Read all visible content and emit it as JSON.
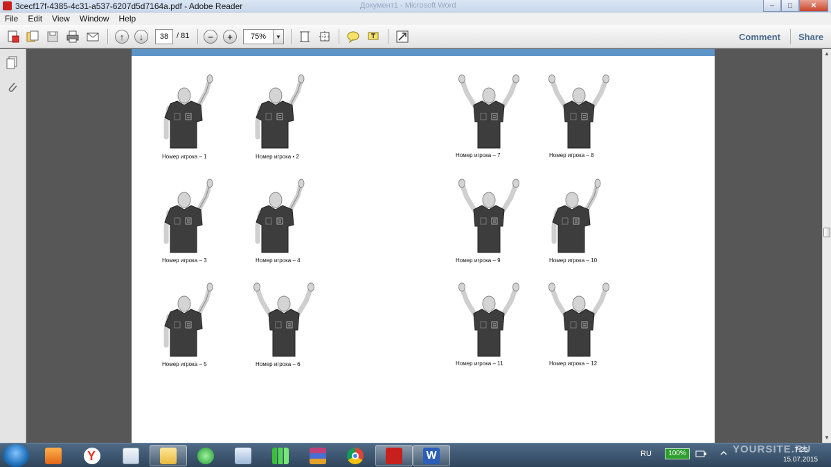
{
  "window": {
    "title": "3cecf17f-4385-4c31-a537-6207d5d7164a.pdf - Adobe Reader",
    "background_title": "Документ1 - Microsoft Word",
    "minimize": "–",
    "maximize": "□",
    "close": "✕"
  },
  "menu": [
    "File",
    "Edit",
    "View",
    "Window",
    "Help"
  ],
  "toolbar": {
    "page_current": "38",
    "page_total": "/ 81",
    "zoom": "75%",
    "comment_label": "Comment",
    "share_label": "Share",
    "icons": [
      "create-pdf-icon",
      "files-icon",
      "save-icon",
      "print-icon",
      "email-icon",
      "prev-page-icon",
      "next-page-icon",
      "zoom-out-icon",
      "zoom-in-icon",
      "fit-page-icon",
      "fit-width-icon",
      "sticky-note-icon",
      "highlight-icon",
      "read-mode-icon"
    ]
  },
  "figures": [
    {
      "caption": "Номер игрока – 1",
      "pose": "right-arm-up"
    },
    {
      "caption": "Номер игрока • 2",
      "pose": "right-arm-up"
    },
    {
      "caption": "Номер игрока – 7",
      "pose": "both-arms-up"
    },
    {
      "caption": "Номер игрока – 8",
      "pose": "both-arms-up"
    },
    {
      "caption": "Номер игрока – 3",
      "pose": "right-arm-up"
    },
    {
      "caption": "Номер игрока – 4",
      "pose": "right-arm-up"
    },
    {
      "caption": "Номер игрока – 9",
      "pose": "both-arms-up"
    },
    {
      "caption": "Номер игрока – 10",
      "pose": "right-arm-up"
    },
    {
      "caption": "Номер игрока – 5",
      "pose": "right-arm-up"
    },
    {
      "caption": "Номер игрока – 6",
      "pose": "both-arms-up"
    },
    {
      "caption": "Номер игрока – 11",
      "pose": "both-arms-up"
    },
    {
      "caption": "Номер игрока – 12",
      "pose": "both-arms-up"
    }
  ],
  "taskbar": {
    "apps": [
      "media-player",
      "yandex-browser",
      "onscreen-keyboard",
      "file-explorer",
      "network-app",
      "audio-app",
      "signal-app",
      "winrar",
      "chrome",
      "adobe-reader",
      "microsoft-word"
    ],
    "active_app": "adobe-reader",
    "language": "RU",
    "battery": "100%",
    "time": "7:25",
    "date": "15.07.2015"
  },
  "watermark": "YOURSITE.RU",
  "colors": {
    "page_strip": "#5e95c9",
    "referee_shirt": "#3d3d3d",
    "skin": "#d0d0d0"
  }
}
